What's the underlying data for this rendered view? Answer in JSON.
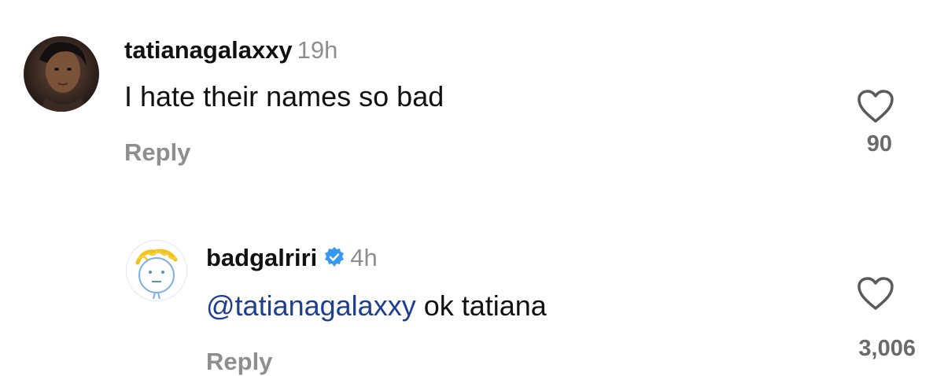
{
  "comments": [
    {
      "username": "tatianagalaxxy",
      "time": "19h",
      "text": "I hate their names so bad",
      "reply_label": "Reply",
      "like_count": "90",
      "verified": false
    },
    {
      "username": "badgalriri",
      "time": "4h",
      "mention": "@tatianagalaxxy",
      "text": " ok tatiana",
      "reply_label": "Reply",
      "like_count": "3,006",
      "verified": true
    }
  ],
  "icons": {
    "like": "heart-outline-icon",
    "verified": "verified-badge-icon"
  },
  "colors": {
    "username": "#111111",
    "secondary": "#8e8e8e",
    "mention": "#1e3f8f",
    "verified": "#3897f0"
  }
}
